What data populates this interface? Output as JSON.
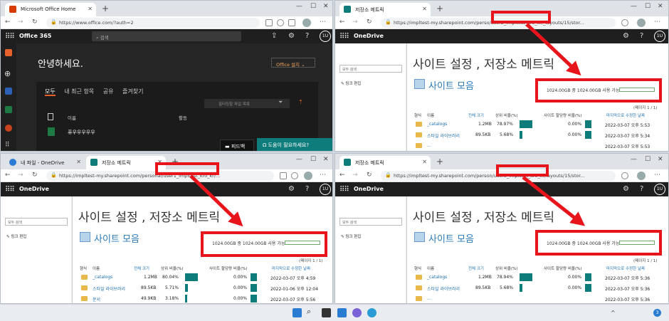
{
  "w1": {
    "tab_title": "Microsoft Office Home",
    "url": "https://www.office.com/?auth=2",
    "suite_name": "Office 365",
    "search_placeholder": "검색",
    "greeting": "안녕하세요.",
    "install_button": "Office 설치",
    "install_chevron": "⌄",
    "filters": [
      "모두",
      "내 최근 항목",
      "공유",
      "즐겨찾기"
    ],
    "filter_placeholder": "필터링할 파일 목록",
    "col_name": "이름",
    "col_activity": "활동",
    "file_name": "퓨우우우우우",
    "feedback": "피드백",
    "help": "도움이 필요하세요?",
    "avatar": "1U"
  },
  "w2": {
    "tab_title": "저장소 메트릭",
    "url_pre": "https://impltest-my.sharepoint.com/perso",
    "url_hl": "/user2_impltest_kro_kr/",
    "url_post": "_layouts/15/stor...",
    "storage": "1024.00GB 중 1024.00GB 사용 가능",
    "rows": [
      {
        "name": "_catalogs",
        "size": "1.2MB",
        "pct": "78.97%",
        "quota": "0.00%",
        "date": "2022-03-07 오후 5:53"
      },
      {
        "name": "스타일 라이브러리",
        "size": "89.5KB",
        "pct": "5.68%",
        "quota": "0.00%",
        "date": "2022-03-07 오후 5:34"
      },
      {
        "name": "...",
        "size": "",
        "pct": "",
        "quota": "",
        "date": "2022-03-07 오후 5:53"
      }
    ]
  },
  "w3": {
    "tab_title": "내 파일 - OneDrive",
    "tab2_title": "저장소 메트릭",
    "url_pre": "https://impltest-my.sharepoint.com/person",
    "url_hl": "al/user1_impltest_kro_kr/",
    "url_post": "...",
    "storage": "1024.00GB 중 1024.00GB 사용 가능",
    "rows": [
      {
        "name": "_catalogs",
        "size": "1.2MB",
        "pct": "80.04%",
        "quota": "0.00%",
        "date": "2022-03-07 오후 4:59"
      },
      {
        "name": "스타일 라이브러리",
        "size": "89.5KB",
        "pct": "5.71%",
        "quota": "0.00%",
        "date": "2022-01-06 오후 12:04"
      },
      {
        "name": "문서",
        "size": "49.9KB",
        "pct": "3.18%",
        "quota": "0.00%",
        "date": "2022-03-07 오후 5:56"
      }
    ]
  },
  "w4": {
    "tab_title": "저장소 메트릭",
    "url_pre": "https://impltest-my.sharepoint.com/person",
    "url_hl": "/user3_impltest_kro_kr/",
    "url_post": "layouts/15/stor...",
    "storage": "1024.00GB 중 1024.00GB 사용 가능",
    "rows": [
      {
        "name": "_catalogs",
        "size": "1.2MB",
        "pct": "78.94%",
        "quota": "0.00%",
        "date": "2022-03-07 오후 5:36"
      },
      {
        "name": "스타일 라이브러리",
        "size": "89.5KB",
        "pct": "5.68%",
        "quota": "0.00%",
        "date": "2022-03-07 오후 5:36"
      },
      {
        "name": "...",
        "size": "",
        "pct": "",
        "quota": "",
        "date": "2022-03-07 오후 5:36"
      }
    ]
  },
  "sp": {
    "app_name": "OneDrive",
    "search_box": "모두 검색",
    "link_edit": "링크 편집",
    "heading": "사이트 설정 , 저장소 메트릭",
    "collection": "사이트 모음",
    "pages": "(페이지 1 / 1)",
    "cols": {
      "type": "형식",
      "name": "이름",
      "size": "전체 크기",
      "pct": "상위 비율(%)",
      "quota": "사이트 할당량 비율(%)",
      "modified": "마지막으로 수정한 날짜"
    },
    "avatar": "1U"
  },
  "taskbar": {
    "notify": "3"
  },
  "colors": {
    "annotation": "#e8141b",
    "teal": "#0e7c7b",
    "link": "#1a6fb0",
    "suite": "#1f1f1f"
  }
}
